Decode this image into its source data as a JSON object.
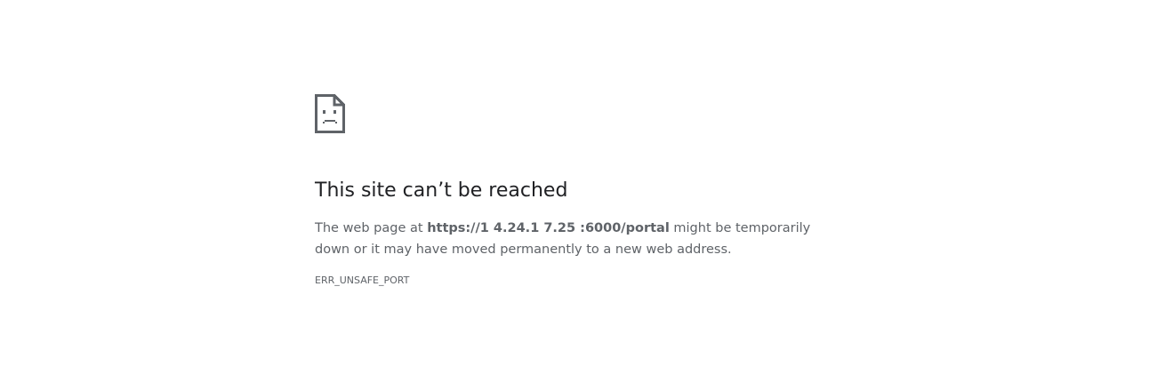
{
  "icon": "sad-page-icon",
  "title": "This site can’t be reached",
  "description": {
    "prefix": "The web page at ",
    "url": "https://1 4.24.1 7.25 :6000/portal",
    "suffix": " might be temporarily down or it may have moved permanently to a new web address."
  },
  "error_code": "ERR_UNSAFE_PORT",
  "colors": {
    "heading": "#202124",
    "text": "#5f6368",
    "background": "#ffffff"
  }
}
